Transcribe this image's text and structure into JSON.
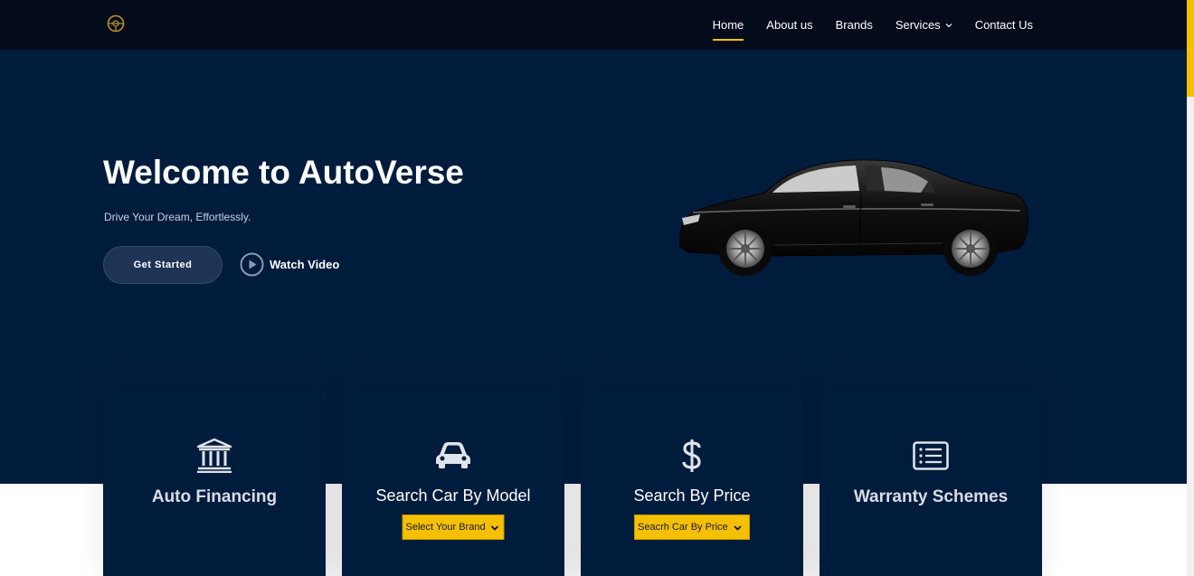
{
  "header": {
    "logo_icon": "wheel-logo-icon",
    "nav": [
      {
        "label": "Home",
        "active": true
      },
      {
        "label": "About us"
      },
      {
        "label": "Brands"
      },
      {
        "label": "Services",
        "dropdown": true
      },
      {
        "label": "Contact Us"
      }
    ]
  },
  "hero": {
    "title": "Welcome to AutoVerse",
    "subtitle": "Drive Your Dream, Effortlessly.",
    "primary_button": "Get Started",
    "video_link": "Watch Video",
    "image": "black-sedan-car"
  },
  "cards": [
    {
      "icon": "bank-icon",
      "title": "Auto Financing"
    },
    {
      "icon": "car-icon",
      "title": "Search Car By Model",
      "select": "Select Your Brand"
    },
    {
      "icon": "dollar-icon",
      "title": "Search By Price",
      "select": "Seacrh Car By Price"
    },
    {
      "icon": "list-icon",
      "title": "Warranty Schemes"
    }
  ],
  "colors": {
    "header_bg": "#040b1a",
    "hero_bg": "#001c3d",
    "accent": "#f5c000"
  }
}
